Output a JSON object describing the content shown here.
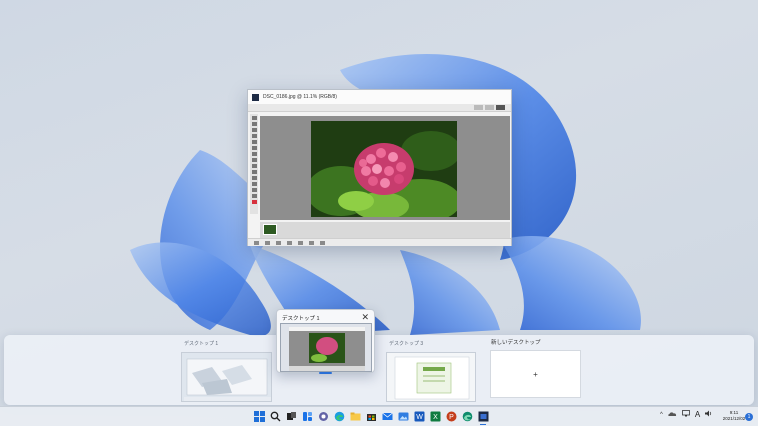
{
  "app_window": {
    "title": "DSC_0186.jpg @ 11.1% (RGB/8)"
  },
  "desktops": [
    {
      "label": "デスクトップ 1"
    },
    {
      "label": "デスクトップ 1"
    },
    {
      "label": "デスクトップ 3"
    }
  ],
  "new_desktop": {
    "label": "新しいデスクトップ",
    "plus": "+"
  },
  "desktop_close_glyph": "✕",
  "taskbar": {
    "icons": [
      "start-icon",
      "search-icon",
      "task-view-icon",
      "widgets-icon",
      "chat-icon",
      "edge-icon",
      "file-explorer-icon",
      "store-icon",
      "mail-icon",
      "photos-icon",
      "word-icon",
      "excel-icon",
      "powerpoint-icon",
      "edge-dev-icon",
      "photoshop-elements-icon"
    ],
    "tray_chevron": "^",
    "ime": "A",
    "clock_time": "9:11",
    "clock_date": "2021/12/02",
    "notification_count": "1"
  },
  "colors": {
    "accent": "#2a6fd6",
    "wallpaper_blue": "#3a7be0"
  }
}
